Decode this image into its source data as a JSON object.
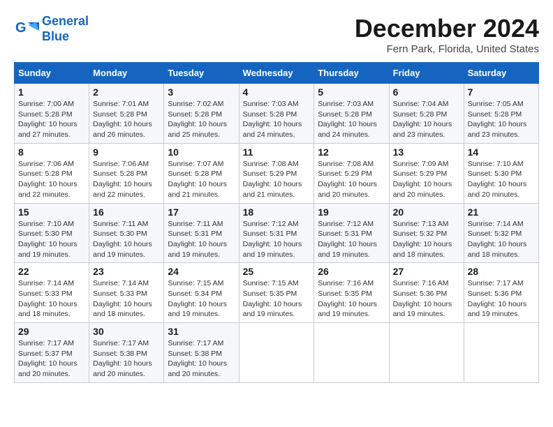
{
  "logo": {
    "line1": "General",
    "line2": "Blue"
  },
  "title": "December 2024",
  "location": "Fern Park, Florida, United States",
  "days_of_week": [
    "Sunday",
    "Monday",
    "Tuesday",
    "Wednesday",
    "Thursday",
    "Friday",
    "Saturday"
  ],
  "weeks": [
    [
      {
        "day": "1",
        "sunrise": "7:00 AM",
        "sunset": "5:28 PM",
        "daylight": "10 hours and 27 minutes."
      },
      {
        "day": "2",
        "sunrise": "7:01 AM",
        "sunset": "5:28 PM",
        "daylight": "10 hours and 26 minutes."
      },
      {
        "day": "3",
        "sunrise": "7:02 AM",
        "sunset": "5:28 PM",
        "daylight": "10 hours and 25 minutes."
      },
      {
        "day": "4",
        "sunrise": "7:03 AM",
        "sunset": "5:28 PM",
        "daylight": "10 hours and 24 minutes."
      },
      {
        "day": "5",
        "sunrise": "7:03 AM",
        "sunset": "5:28 PM",
        "daylight": "10 hours and 24 minutes."
      },
      {
        "day": "6",
        "sunrise": "7:04 AM",
        "sunset": "5:28 PM",
        "daylight": "10 hours and 23 minutes."
      },
      {
        "day": "7",
        "sunrise": "7:05 AM",
        "sunset": "5:28 PM",
        "daylight": "10 hours and 23 minutes."
      }
    ],
    [
      {
        "day": "8",
        "sunrise": "7:06 AM",
        "sunset": "5:28 PM",
        "daylight": "10 hours and 22 minutes."
      },
      {
        "day": "9",
        "sunrise": "7:06 AM",
        "sunset": "5:28 PM",
        "daylight": "10 hours and 22 minutes."
      },
      {
        "day": "10",
        "sunrise": "7:07 AM",
        "sunset": "5:28 PM",
        "daylight": "10 hours and 21 minutes."
      },
      {
        "day": "11",
        "sunrise": "7:08 AM",
        "sunset": "5:29 PM",
        "daylight": "10 hours and 21 minutes."
      },
      {
        "day": "12",
        "sunrise": "7:08 AM",
        "sunset": "5:29 PM",
        "daylight": "10 hours and 20 minutes."
      },
      {
        "day": "13",
        "sunrise": "7:09 AM",
        "sunset": "5:29 PM",
        "daylight": "10 hours and 20 minutes."
      },
      {
        "day": "14",
        "sunrise": "7:10 AM",
        "sunset": "5:30 PM",
        "daylight": "10 hours and 20 minutes."
      }
    ],
    [
      {
        "day": "15",
        "sunrise": "7:10 AM",
        "sunset": "5:30 PM",
        "daylight": "10 hours and 19 minutes."
      },
      {
        "day": "16",
        "sunrise": "7:11 AM",
        "sunset": "5:30 PM",
        "daylight": "10 hours and 19 minutes."
      },
      {
        "day": "17",
        "sunrise": "7:11 AM",
        "sunset": "5:31 PM",
        "daylight": "10 hours and 19 minutes."
      },
      {
        "day": "18",
        "sunrise": "7:12 AM",
        "sunset": "5:31 PM",
        "daylight": "10 hours and 19 minutes."
      },
      {
        "day": "19",
        "sunrise": "7:12 AM",
        "sunset": "5:31 PM",
        "daylight": "10 hours and 19 minutes."
      },
      {
        "day": "20",
        "sunrise": "7:13 AM",
        "sunset": "5:32 PM",
        "daylight": "10 hours and 18 minutes."
      },
      {
        "day": "21",
        "sunrise": "7:14 AM",
        "sunset": "5:32 PM",
        "daylight": "10 hours and 18 minutes."
      }
    ],
    [
      {
        "day": "22",
        "sunrise": "7:14 AM",
        "sunset": "5:33 PM",
        "daylight": "10 hours and 18 minutes."
      },
      {
        "day": "23",
        "sunrise": "7:14 AM",
        "sunset": "5:33 PM",
        "daylight": "10 hours and 18 minutes."
      },
      {
        "day": "24",
        "sunrise": "7:15 AM",
        "sunset": "5:34 PM",
        "daylight": "10 hours and 19 minutes."
      },
      {
        "day": "25",
        "sunrise": "7:15 AM",
        "sunset": "5:35 PM",
        "daylight": "10 hours and 19 minutes."
      },
      {
        "day": "26",
        "sunrise": "7:16 AM",
        "sunset": "5:35 PM",
        "daylight": "10 hours and 19 minutes."
      },
      {
        "day": "27",
        "sunrise": "7:16 AM",
        "sunset": "5:36 PM",
        "daylight": "10 hours and 19 minutes."
      },
      {
        "day": "28",
        "sunrise": "7:17 AM",
        "sunset": "5:36 PM",
        "daylight": "10 hours and 19 minutes."
      }
    ],
    [
      {
        "day": "29",
        "sunrise": "7:17 AM",
        "sunset": "5:37 PM",
        "daylight": "10 hours and 20 minutes."
      },
      {
        "day": "30",
        "sunrise": "7:17 AM",
        "sunset": "5:38 PM",
        "daylight": "10 hours and 20 minutes."
      },
      {
        "day": "31",
        "sunrise": "7:17 AM",
        "sunset": "5:38 PM",
        "daylight": "10 hours and 20 minutes."
      },
      null,
      null,
      null,
      null
    ]
  ]
}
